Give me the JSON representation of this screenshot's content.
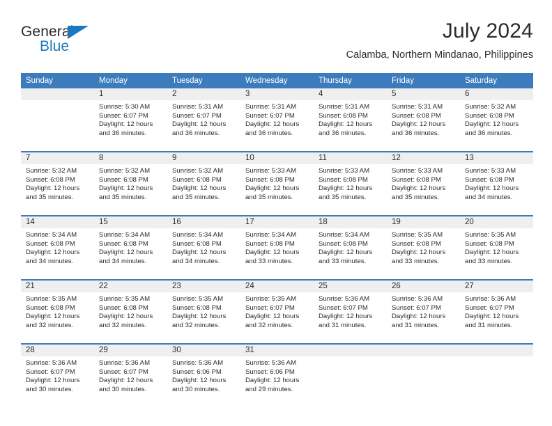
{
  "brand": {
    "name_part1": "General",
    "name_part2": "Blue",
    "accent_color": "#1a79c0"
  },
  "header": {
    "title": "July 2024",
    "subtitle": "Calamba, Northern Mindanao, Philippines"
  },
  "colors": {
    "header_row": "#3c7cbd",
    "daynum_band": "#efefef",
    "text": "#2b2b2b",
    "page_background": "#ffffff"
  },
  "weekday_headers": [
    "Sunday",
    "Monday",
    "Tuesday",
    "Wednesday",
    "Thursday",
    "Friday",
    "Saturday"
  ],
  "labels": {
    "sunrise_prefix": "Sunrise:",
    "sunset_prefix": "Sunset:",
    "daylight_prefix": "Daylight:"
  },
  "weeks": [
    [
      {
        "day": "",
        "empty": true,
        "line1": "",
        "line2": "",
        "line3": "",
        "line4": ""
      },
      {
        "day": "1",
        "empty": false,
        "line1": "Sunrise: 5:30 AM",
        "line2": "Sunset: 6:07 PM",
        "line3": "Daylight: 12 hours",
        "line4": "and 36 minutes."
      },
      {
        "day": "2",
        "empty": false,
        "line1": "Sunrise: 5:31 AM",
        "line2": "Sunset: 6:07 PM",
        "line3": "Daylight: 12 hours",
        "line4": "and 36 minutes."
      },
      {
        "day": "3",
        "empty": false,
        "line1": "Sunrise: 5:31 AM",
        "line2": "Sunset: 6:07 PM",
        "line3": "Daylight: 12 hours",
        "line4": "and 36 minutes."
      },
      {
        "day": "4",
        "empty": false,
        "line1": "Sunrise: 5:31 AM",
        "line2": "Sunset: 6:08 PM",
        "line3": "Daylight: 12 hours",
        "line4": "and 36 minutes."
      },
      {
        "day": "5",
        "empty": false,
        "line1": "Sunrise: 5:31 AM",
        "line2": "Sunset: 6:08 PM",
        "line3": "Daylight: 12 hours",
        "line4": "and 36 minutes."
      },
      {
        "day": "6",
        "empty": false,
        "line1": "Sunrise: 5:32 AM",
        "line2": "Sunset: 6:08 PM",
        "line3": "Daylight: 12 hours",
        "line4": "and 36 minutes."
      }
    ],
    [
      {
        "day": "7",
        "empty": false,
        "line1": "Sunrise: 5:32 AM",
        "line2": "Sunset: 6:08 PM",
        "line3": "Daylight: 12 hours",
        "line4": "and 35 minutes."
      },
      {
        "day": "8",
        "empty": false,
        "line1": "Sunrise: 5:32 AM",
        "line2": "Sunset: 6:08 PM",
        "line3": "Daylight: 12 hours",
        "line4": "and 35 minutes."
      },
      {
        "day": "9",
        "empty": false,
        "line1": "Sunrise: 5:32 AM",
        "line2": "Sunset: 6:08 PM",
        "line3": "Daylight: 12 hours",
        "line4": "and 35 minutes."
      },
      {
        "day": "10",
        "empty": false,
        "line1": "Sunrise: 5:33 AM",
        "line2": "Sunset: 6:08 PM",
        "line3": "Daylight: 12 hours",
        "line4": "and 35 minutes."
      },
      {
        "day": "11",
        "empty": false,
        "line1": "Sunrise: 5:33 AM",
        "line2": "Sunset: 6:08 PM",
        "line3": "Daylight: 12 hours",
        "line4": "and 35 minutes."
      },
      {
        "day": "12",
        "empty": false,
        "line1": "Sunrise: 5:33 AM",
        "line2": "Sunset: 6:08 PM",
        "line3": "Daylight: 12 hours",
        "line4": "and 35 minutes."
      },
      {
        "day": "13",
        "empty": false,
        "line1": "Sunrise: 5:33 AM",
        "line2": "Sunset: 6:08 PM",
        "line3": "Daylight: 12 hours",
        "line4": "and 34 minutes."
      }
    ],
    [
      {
        "day": "14",
        "empty": false,
        "line1": "Sunrise: 5:34 AM",
        "line2": "Sunset: 6:08 PM",
        "line3": "Daylight: 12 hours",
        "line4": "and 34 minutes."
      },
      {
        "day": "15",
        "empty": false,
        "line1": "Sunrise: 5:34 AM",
        "line2": "Sunset: 6:08 PM",
        "line3": "Daylight: 12 hours",
        "line4": "and 34 minutes."
      },
      {
        "day": "16",
        "empty": false,
        "line1": "Sunrise: 5:34 AM",
        "line2": "Sunset: 6:08 PM",
        "line3": "Daylight: 12 hours",
        "line4": "and 34 minutes."
      },
      {
        "day": "17",
        "empty": false,
        "line1": "Sunrise: 5:34 AM",
        "line2": "Sunset: 6:08 PM",
        "line3": "Daylight: 12 hours",
        "line4": "and 33 minutes."
      },
      {
        "day": "18",
        "empty": false,
        "line1": "Sunrise: 5:34 AM",
        "line2": "Sunset: 6:08 PM",
        "line3": "Daylight: 12 hours",
        "line4": "and 33 minutes."
      },
      {
        "day": "19",
        "empty": false,
        "line1": "Sunrise: 5:35 AM",
        "line2": "Sunset: 6:08 PM",
        "line3": "Daylight: 12 hours",
        "line4": "and 33 minutes."
      },
      {
        "day": "20",
        "empty": false,
        "line1": "Sunrise: 5:35 AM",
        "line2": "Sunset: 6:08 PM",
        "line3": "Daylight: 12 hours",
        "line4": "and 33 minutes."
      }
    ],
    [
      {
        "day": "21",
        "empty": false,
        "line1": "Sunrise: 5:35 AM",
        "line2": "Sunset: 6:08 PM",
        "line3": "Daylight: 12 hours",
        "line4": "and 32 minutes."
      },
      {
        "day": "22",
        "empty": false,
        "line1": "Sunrise: 5:35 AM",
        "line2": "Sunset: 6:08 PM",
        "line3": "Daylight: 12 hours",
        "line4": "and 32 minutes."
      },
      {
        "day": "23",
        "empty": false,
        "line1": "Sunrise: 5:35 AM",
        "line2": "Sunset: 6:08 PM",
        "line3": "Daylight: 12 hours",
        "line4": "and 32 minutes."
      },
      {
        "day": "24",
        "empty": false,
        "line1": "Sunrise: 5:35 AM",
        "line2": "Sunset: 6:07 PM",
        "line3": "Daylight: 12 hours",
        "line4": "and 32 minutes."
      },
      {
        "day": "25",
        "empty": false,
        "line1": "Sunrise: 5:36 AM",
        "line2": "Sunset: 6:07 PM",
        "line3": "Daylight: 12 hours",
        "line4": "and 31 minutes."
      },
      {
        "day": "26",
        "empty": false,
        "line1": "Sunrise: 5:36 AM",
        "line2": "Sunset: 6:07 PM",
        "line3": "Daylight: 12 hours",
        "line4": "and 31 minutes."
      },
      {
        "day": "27",
        "empty": false,
        "line1": "Sunrise: 5:36 AM",
        "line2": "Sunset: 6:07 PM",
        "line3": "Daylight: 12 hours",
        "line4": "and 31 minutes."
      }
    ],
    [
      {
        "day": "28",
        "empty": false,
        "line1": "Sunrise: 5:36 AM",
        "line2": "Sunset: 6:07 PM",
        "line3": "Daylight: 12 hours",
        "line4": "and 30 minutes."
      },
      {
        "day": "29",
        "empty": false,
        "line1": "Sunrise: 5:36 AM",
        "line2": "Sunset: 6:07 PM",
        "line3": "Daylight: 12 hours",
        "line4": "and 30 minutes."
      },
      {
        "day": "30",
        "empty": false,
        "line1": "Sunrise: 5:36 AM",
        "line2": "Sunset: 6:06 PM",
        "line3": "Daylight: 12 hours",
        "line4": "and 30 minutes."
      },
      {
        "day": "31",
        "empty": false,
        "line1": "Sunrise: 5:36 AM",
        "line2": "Sunset: 6:06 PM",
        "line3": "Daylight: 12 hours",
        "line4": "and 29 minutes."
      },
      {
        "day": "",
        "empty": true,
        "line1": "",
        "line2": "",
        "line3": "",
        "line4": ""
      },
      {
        "day": "",
        "empty": true,
        "line1": "",
        "line2": "",
        "line3": "",
        "line4": ""
      },
      {
        "day": "",
        "empty": true,
        "line1": "",
        "line2": "",
        "line3": "",
        "line4": ""
      }
    ]
  ]
}
